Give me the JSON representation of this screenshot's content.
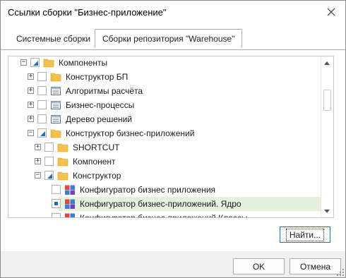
{
  "dialog": {
    "title": "Ссылки сборки \"Бизнес-приложение\"",
    "close_icon": "close-icon"
  },
  "tabs": [
    {
      "label": "Системные сборки",
      "active": false
    },
    {
      "label": "Сборки репозитория \"Warehouse\"",
      "active": true
    }
  ],
  "tree": {
    "items": [
      {
        "label": "Компоненты",
        "expander": "−",
        "check": "partial",
        "icon": "folder-icon"
      },
      {
        "label": "Конструктор БП",
        "expander": "+",
        "check": "none",
        "icon": "folder-icon"
      },
      {
        "label": "Алгоритмы расчёта",
        "expander": "+",
        "check": "none",
        "icon": "assembly-icon"
      },
      {
        "label": "Бизнес-процессы",
        "expander": "+",
        "check": "none",
        "icon": "assembly-icon"
      },
      {
        "label": "Дерево решений",
        "expander": "+",
        "check": "none",
        "icon": "assembly-icon"
      },
      {
        "label": "Конструктор бизнес-приложений",
        "expander": "−",
        "check": "partial",
        "icon": "folder-icon"
      },
      {
        "label": "SHORTCUT",
        "expander": "+",
        "check": "none",
        "icon": "folder-icon"
      },
      {
        "label": "Компонент",
        "expander": "+",
        "check": "none",
        "icon": "folder-icon"
      },
      {
        "label": "Конструктор",
        "expander": "−",
        "check": "partial",
        "icon": "folder-icon"
      },
      {
        "label": "Конфигуратор бизнес приложения",
        "expander": "",
        "check": "none",
        "icon": "module-icon"
      },
      {
        "label": "Конфигуратор бизнес-приложений. Ядро",
        "expander": "",
        "check": "checked",
        "icon": "module-icon",
        "selected": true
      },
      {
        "label": "Конфигуратор бизнес-приложений Классы",
        "expander": "",
        "check": "none",
        "icon": "module-icon"
      }
    ]
  },
  "buttons": {
    "find": "Найти...",
    "ok": "OK",
    "cancel": "Отмена"
  },
  "colors": {
    "accent": "#1e6fc3",
    "folder": "#f4c24a",
    "selection": "#e3f1de"
  }
}
